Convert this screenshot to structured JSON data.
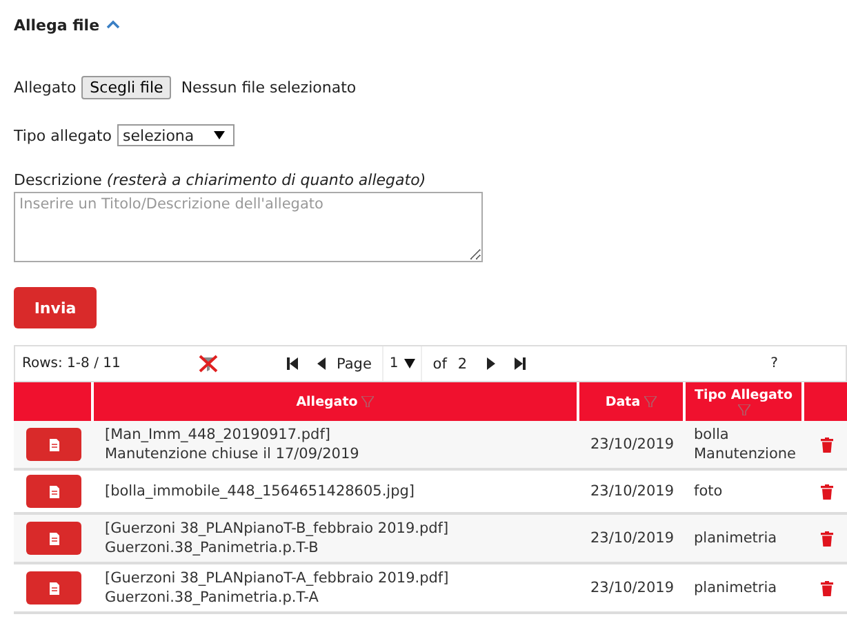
{
  "section": {
    "title": "Allega file",
    "expanded": true
  },
  "form": {
    "file_label": "Allegato",
    "file_button": "Scegli file",
    "file_status": "Nessun file selezionato",
    "type_label": "Tipo allegato",
    "type_value": "seleziona",
    "description_label": "Descrizione *(resterà a chiarimento di quanto allegato)*",
    "description_placeholder": "Inserire un Titolo/Descrizione dell'allegato",
    "submit": "Invia"
  },
  "pager": {
    "rows": "Rows: 1-8 / 11",
    "page_label": "Page",
    "page": "1",
    "of_label": "of",
    "pages": "2",
    "help": "?"
  },
  "table": {
    "columns": [
      "Allegato",
      "Data",
      "Tipo Allegato"
    ],
    "rows": [
      {
        "file": "[Man_Imm_448_20190917.pdf]",
        "description": "Manutenzione chiuse il 17/09/2019",
        "date": "23/10/2019",
        "type": "bolla Manutenzione"
      },
      {
        "file": "[bolla_immobile_448_1564651428605.jpg]",
        "date": "23/10/2019",
        "type": "foto"
      },
      {
        "file": "[Guerzoni 38_PLANpianoT-B_febbraio 2019.pdf]",
        "description": "Guerzoni.38_Panimetria.p.T-B",
        "date": "23/10/2019",
        "type": "planimetria"
      },
      {
        "file": "[Guerzoni 38_PLANpianoT-A_febbraio 2019.pdf]",
        "description": "Guerzoni.38_Panimetria.p.T-A",
        "date": "23/10/2019",
        "type": "planimetria"
      }
    ]
  }
}
